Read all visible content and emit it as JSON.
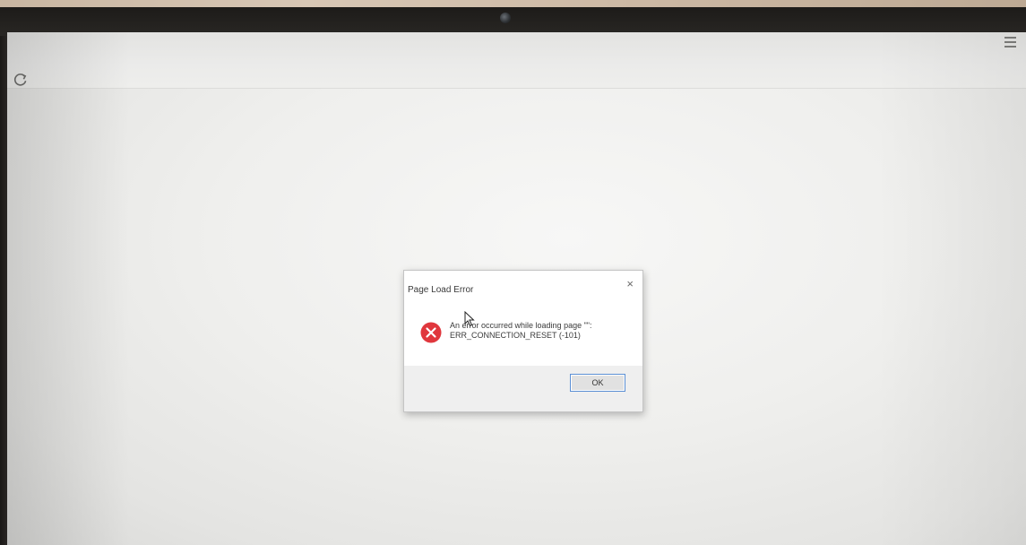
{
  "menu": {
    "icon": "hamburger-menu-icon"
  },
  "toolbar": {
    "reload_icon": "reload-icon"
  },
  "dialog": {
    "title": "Page Load Error",
    "close_label": "×",
    "message_line1": "An error occurred while loading page \"\":",
    "message_line2": "ERR_CONNECTION_RESET (-101)",
    "ok_label": "OK",
    "icon": "error-icon"
  },
  "colors": {
    "error_red": "#e0373d",
    "button_border": "#5b8fd4"
  }
}
